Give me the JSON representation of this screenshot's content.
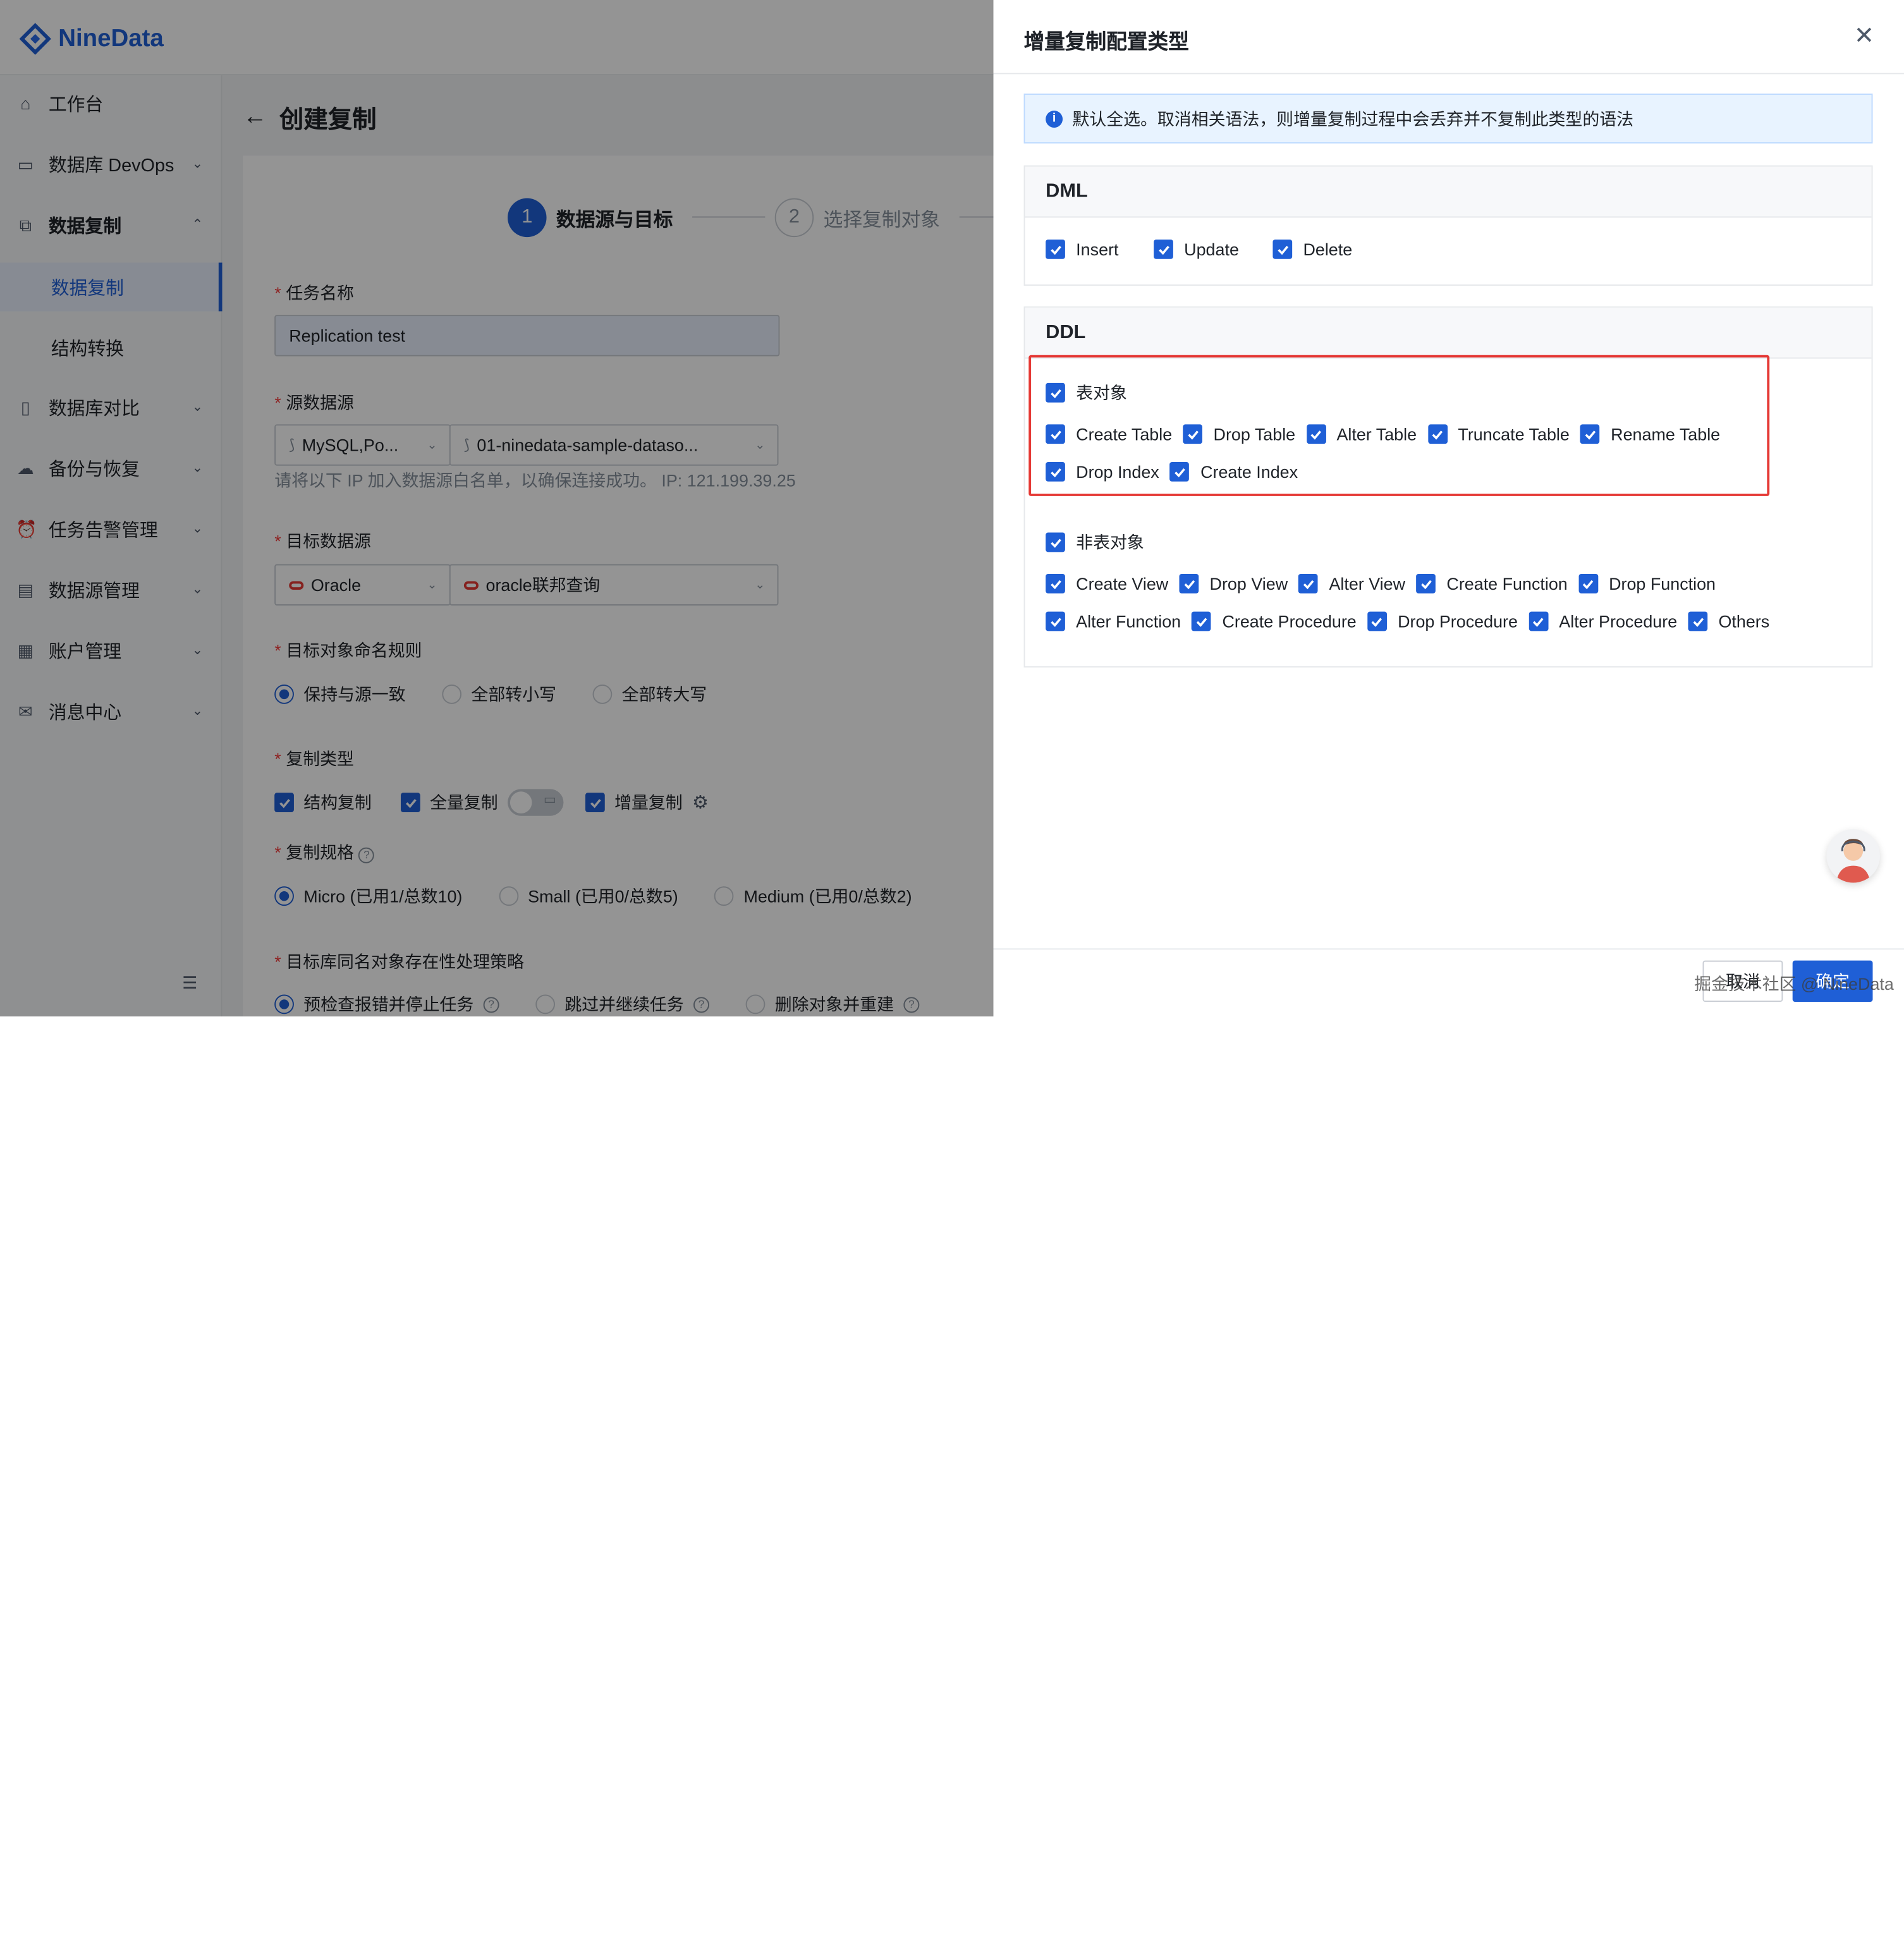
{
  "app": {
    "name": "NineData"
  },
  "sidebar": {
    "items": [
      {
        "label": "工作台",
        "icon": "home-icon"
      },
      {
        "label": "数据库 DevOps",
        "icon": "devops-icon"
      },
      {
        "label": "数据复制",
        "icon": "replication-icon"
      },
      {
        "label": "数据复制",
        "icon": ""
      },
      {
        "label": "结构转换",
        "icon": ""
      },
      {
        "label": "数据库对比",
        "icon": "compare-icon"
      },
      {
        "label": "备份与恢复",
        "icon": "backup-icon"
      },
      {
        "label": "任务告警管理",
        "icon": "alarm-icon"
      },
      {
        "label": "数据源管理",
        "icon": "datasource-icon"
      },
      {
        "label": "账户管理",
        "icon": "account-icon"
      },
      {
        "label": "消息中心",
        "icon": "message-icon"
      }
    ]
  },
  "page": {
    "title": "创建复制",
    "steps": [
      {
        "num": "1",
        "label": "数据源与目标"
      },
      {
        "num": "2",
        "label": "选择复制对象"
      }
    ],
    "task_name": {
      "label": "任务名称",
      "value": "Replication test"
    },
    "source": {
      "label": "源数据源",
      "type": "MySQL,Po...",
      "name": "01-ninedata-sample-dataso...",
      "hint": "请将以下 IP 加入数据源白名单，以确保连接成功。 IP: 121.199.39.25"
    },
    "target": {
      "label": "目标数据源",
      "type": "Oracle",
      "name": "oracle联邦查询"
    },
    "naming": {
      "label": "目标对象命名规则",
      "options": [
        "保持与源一致",
        "全部转小写",
        "全部转大写"
      ],
      "selected": "保持与源一致"
    },
    "copy_type": {
      "label": "复制类型",
      "options": [
        "结构复制",
        "全量复制",
        "增量复制"
      ]
    },
    "spec": {
      "label": "复制规格",
      "options": [
        "Micro (已用1/总数10)",
        "Small (已用0/总数5)",
        "Medium (已用0/总数2)"
      ],
      "selected": "Micro (已用1/总数10)"
    },
    "conflict": {
      "label": "目标库同名对象存在性处理策略",
      "options": [
        "预检查报错并停止任务",
        "跳过并继续任务",
        "删除对象并重建"
      ],
      "selected": "预检查报错并停止任务"
    }
  },
  "drawer": {
    "title": "增量复制配置类型",
    "alert": "默认全选。取消相关语法，则增量复制过程中会丢弃并不复制此类型的语法",
    "dml": {
      "title": "DML",
      "items": [
        "Insert",
        "Update",
        "Delete"
      ]
    },
    "ddl": {
      "title": "DDL",
      "table_group": "表对象",
      "table_items_row1": [
        "Create Table",
        "Drop Table",
        "Alter Table",
        "Truncate Table",
        "Rename Table"
      ],
      "table_items_row2": [
        "Drop Index",
        "Create Index"
      ],
      "nontable_group": "非表对象",
      "nontable_items_row1": [
        "Create View",
        "Drop View",
        "Alter View",
        "Create Function",
        "Drop Function"
      ],
      "nontable_items_row2": [
        "Alter Function",
        "Create Procedure",
        "Drop Procedure",
        "Alter Procedure",
        "Others"
      ]
    },
    "cancel_label": "取消",
    "ok_label": "确定"
  },
  "watermark": "掘金技术社区 @ NineData",
  "colors": {
    "primary": "#1f5fd6",
    "highlight": "#e53935"
  }
}
